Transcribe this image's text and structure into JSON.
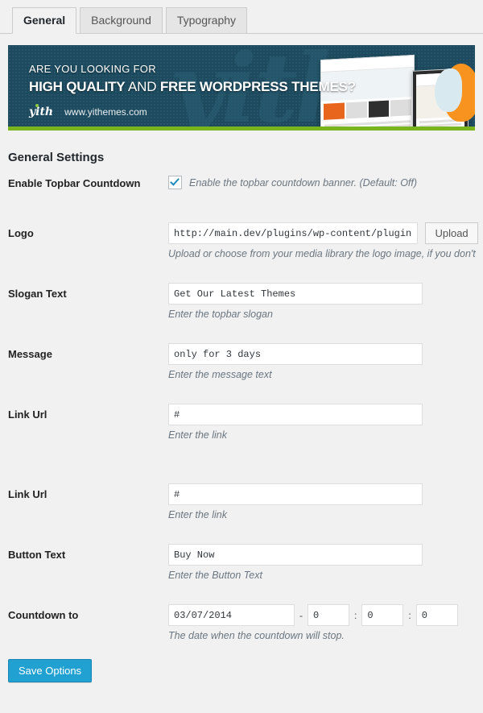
{
  "tabs": [
    {
      "label": "General",
      "active": true
    },
    {
      "label": "Background",
      "active": false
    },
    {
      "label": "Typography",
      "active": false
    }
  ],
  "banner": {
    "line1": "ARE YOU LOOKING FOR",
    "line2_strong_a": "HIGH QUALITY",
    "line2_thin": " AND ",
    "line2_strong_b": "FREE WORDPRESS THEMES?",
    "brand": "yith",
    "url": "www.yithemes.com",
    "watermark": "yith",
    "bg_color": "#1d4a5e",
    "stripe_color": "#7ab51d"
  },
  "section": {
    "title": "General Settings"
  },
  "fields": {
    "enable_topbar": {
      "label": "Enable Topbar Countdown",
      "checked": true,
      "description": "Enable the topbar countdown banner. (Default: Off)"
    },
    "logo": {
      "label": "Logo",
      "value": "http://main.dev/plugins/wp-content/plugins/y",
      "placeholder": "",
      "upload_label": "Upload",
      "description": "Upload or choose from your media library the logo image, if you don't"
    },
    "slogan": {
      "label": "Slogan Text",
      "value": "Get Our Latest Themes",
      "placeholder": "",
      "description": "Enter the topbar slogan"
    },
    "message": {
      "label": "Message",
      "value": "only for 3 days",
      "placeholder": "",
      "description": "Enter the message text"
    },
    "link_url_1": {
      "label": "Link Url",
      "value": "#",
      "placeholder": "",
      "description": "Enter the link"
    },
    "link_url_2": {
      "label": "Link Url",
      "value": "#",
      "placeholder": "",
      "description": "Enter the link"
    },
    "button_text": {
      "label": "Button Text",
      "value": "Buy Now",
      "placeholder": "",
      "description": "Enter the Button Text"
    },
    "countdown": {
      "label": "Countdown to",
      "date_value": "03/07/2014",
      "sep_dash": "-",
      "sep_colon_1": ":",
      "sep_colon_2": ":",
      "hours": "0",
      "minutes": "0",
      "seconds": "0",
      "description": "The date when the countdown will stop."
    }
  },
  "actions": {
    "save_label": "Save Options",
    "save_color": "#21a0d2"
  }
}
